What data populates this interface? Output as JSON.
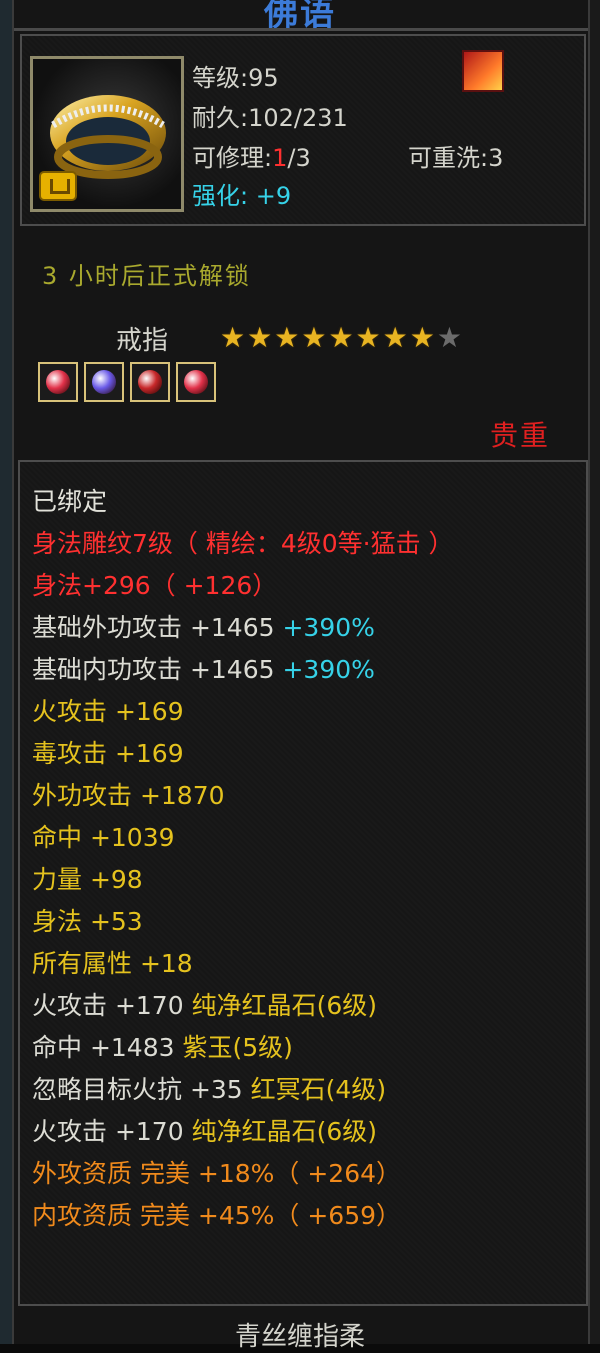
{
  "title": "佛语",
  "item": {
    "icon": "gold-ring-icon",
    "level_label": "等级",
    "level": "95",
    "durability_label": "耐久",
    "durability": "102/231",
    "repair_label": "可修理",
    "repair_current": "1",
    "repair_max": "/3",
    "rewash_label": "可重洗",
    "rewash": "3",
    "enhance_label": "强化",
    "enhance": "+9"
  },
  "unlock_text": "3 小时后正式解锁",
  "slot_name": "戒指",
  "stars": {
    "filled": 8,
    "total": 9
  },
  "gems": [
    {
      "name": "red-gem-icon",
      "color": "#e2324a"
    },
    {
      "name": "purple-gem-icon",
      "color": "#6a5ae8"
    },
    {
      "name": "crimson-gem-icon",
      "color": "#c8282a"
    },
    {
      "name": "red-gem-icon",
      "color": "#e2324a"
    }
  ],
  "rarity": "贵重",
  "attributes": [
    {
      "text": "已绑定",
      "color": "bound"
    },
    {
      "text": "身法雕纹7级（ 精绘：4级0等·猛击 ）",
      "color": "red"
    },
    {
      "text": "身法+296（ +126）",
      "color": "red"
    },
    {
      "text": "基础外功攻击 +1465 ",
      "extra": "+390%",
      "color": "white"
    },
    {
      "text": "基础内功攻击 +1465 ",
      "extra": "+390%",
      "color": "white"
    },
    {
      "text": "火攻击 +169",
      "color": "yellow"
    },
    {
      "text": "毒攻击 +169",
      "color": "yellow"
    },
    {
      "text": "外功攻击 +1870",
      "color": "yellow"
    },
    {
      "text": "命中 +1039",
      "color": "yellow"
    },
    {
      "text": "力量 +98",
      "color": "yellow"
    },
    {
      "text": "身法 +53",
      "color": "yellow"
    },
    {
      "text": "所有属性 +18",
      "color": "yellow"
    },
    {
      "prefix": "火攻击 +170 ",
      "text": "纯净红晶石(6级)",
      "color": "yellow"
    },
    {
      "prefix": "命中 +1483 ",
      "text": "紫玉(5级)",
      "color": "yellow"
    },
    {
      "prefix": "忽略目标火抗 +35 ",
      "text": "红冥石(4级)",
      "color": "yellow"
    },
    {
      "prefix": "火攻击 +170 ",
      "text": "纯净红晶石(6级)",
      "color": "yellow"
    },
    {
      "text": "外攻资质  完美 +18%（ +264）",
      "color": "orange"
    },
    {
      "text": "内攻资质  完美 +45%（ +659）",
      "color": "orange"
    }
  ],
  "footer_text": "青丝缠指柔"
}
